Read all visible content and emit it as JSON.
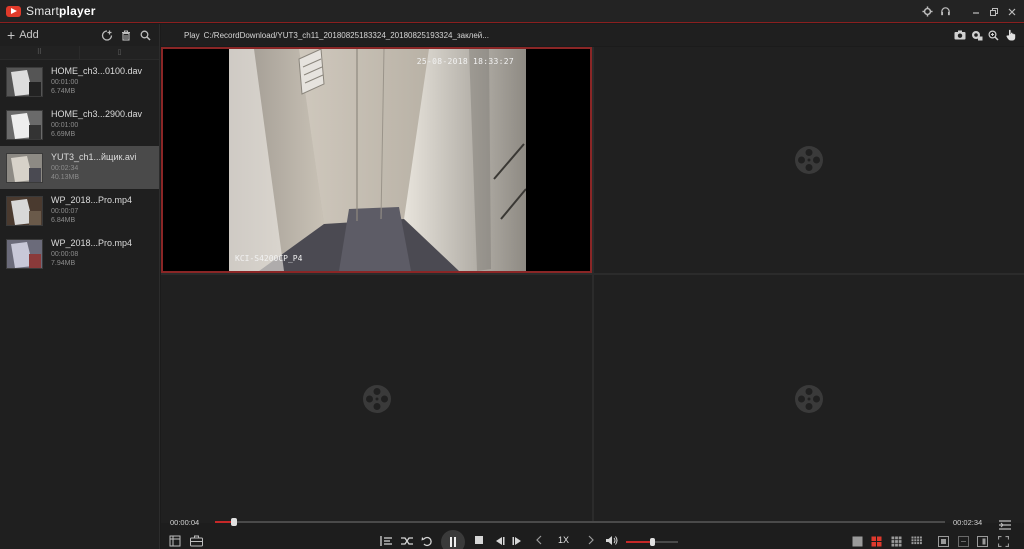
{
  "app": {
    "title_light": "Smart",
    "title_bold": "player"
  },
  "window_controls": [
    "gear-icon",
    "headset-icon",
    "minimize-icon",
    "restore-icon",
    "close-icon"
  ],
  "sidebar": {
    "add_label": "Add",
    "files": [
      {
        "name": "HOME_ch3...0100.dav",
        "duration": "00:01:00",
        "size": "6.74MB",
        "selected": false
      },
      {
        "name": "HOME_ch3...2900.dav",
        "duration": "00:01:00",
        "size": "6.69MB",
        "selected": false
      },
      {
        "name": "YUT3_ch1...йщик.avi",
        "duration": "00:02:34",
        "size": "40.13MB",
        "selected": true
      },
      {
        "name": "WP_2018...Pro.mp4",
        "duration": "00:00:07",
        "size": "6.84MB",
        "selected": false
      },
      {
        "name": "WP_2018...Pro.mp4",
        "duration": "00:00:08",
        "size": "7.94MB",
        "selected": false
      }
    ]
  },
  "pathbar": {
    "play_label": "Play",
    "path": "C:/RecordDownload/YUT3_ch11_20180825183324_20180825193324_заклей..."
  },
  "video": {
    "osd_time": "25-08-2018 18:33:27",
    "osd_camera": "KCI-S4200CP_P4"
  },
  "playback": {
    "current_time": "00:00:04",
    "total_time": "00:02:34",
    "progress_fraction": 0.026,
    "speed": "1X",
    "volume_fraction": 0.5
  },
  "colors": {
    "accent": "#c62828",
    "active_border": "#8a2626",
    "background": "#1b1b1b"
  }
}
